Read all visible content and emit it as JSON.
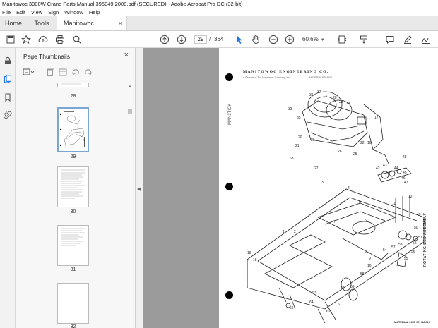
{
  "window": {
    "title": "Manitowoc 3900W Crane Parts Manual 395049 2008.pdf (SECURED) - Adobe Acrobat Pro DC (32-bit)"
  },
  "menu": [
    "File",
    "Edit",
    "View",
    "Sign",
    "Window",
    "Help"
  ],
  "tabs": {
    "home": "Home",
    "tools": "Tools",
    "document": "Manitowoc 3900W...",
    "close": "×"
  },
  "toolbar": {
    "current_page": "29",
    "separator": "/",
    "page_count": "364",
    "zoom": "60.6%"
  },
  "thumbnail_panel": {
    "title": "Page Thumbnails",
    "close": "×",
    "thumbnails": [
      {
        "label": "28"
      },
      {
        "label": "29"
      },
      {
        "label": "30"
      },
      {
        "label": "31"
      },
      {
        "label": "32"
      }
    ]
  },
  "page": {
    "header": "MANITOWOC ENGINEERING CO.",
    "subheader": "A Division of The Manitowoc Company, Inc.",
    "figure_ref": "MATERIAL PR-4347",
    "stamp": "MAN3TICK",
    "side_label": "ROTATING BED ASSEMBLY",
    "footer": "MATERIAL LIST ON BACK",
    "part_numbers": [
      "33",
      "36",
      "37",
      "31",
      "28",
      "23",
      "24",
      "25",
      "26",
      "27",
      "29",
      "30",
      "32",
      "35",
      "38",
      "39",
      "40",
      "41",
      "42",
      "43",
      "44",
      "45",
      "46",
      "47",
      "48",
      "49",
      "50",
      "51",
      "52",
      "53",
      "54",
      "55",
      "56",
      "57",
      "58",
      "59",
      "60",
      "61",
      "62",
      "63",
      "64",
      "1",
      "2",
      "3",
      "4",
      "5",
      "6",
      "7",
      "8",
      "9",
      "10",
      "11",
      "12",
      "14",
      "16",
      "17",
      "18",
      "19",
      "20",
      "21",
      "22",
      "65",
      "66",
      "67",
      "68"
    ]
  },
  "colors": {
    "accent": "#1a73e8",
    "viewer_bg": "#9b9b9b",
    "selected_thumb": "#7aa6d6"
  }
}
